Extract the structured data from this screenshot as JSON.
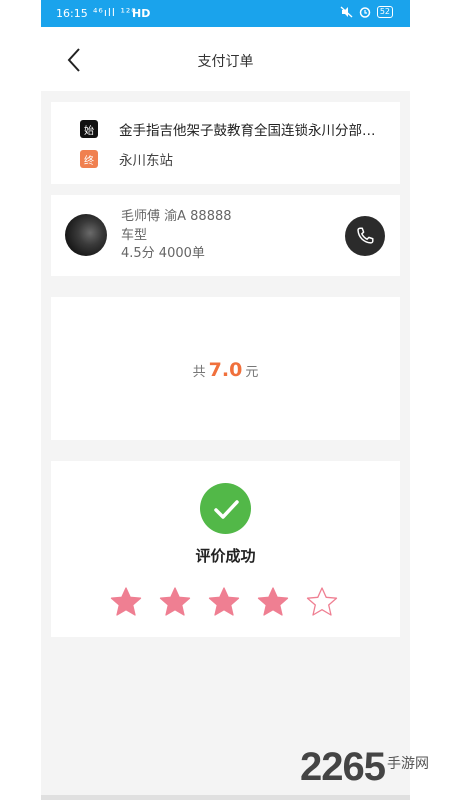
{
  "status_bar": {
    "time": "16:15",
    "signal": "⁴⁶ıll ¹²⁰",
    "network": "HD",
    "battery": "52"
  },
  "header": {
    "title": "支付订单"
  },
  "route": {
    "start_tag": "始",
    "start": "金手指吉他架子鼓教育全国连锁永川分部…",
    "end_tag": "终",
    "end": "永川东站"
  },
  "driver": {
    "name_plate": "毛师傅 渝A 88888",
    "car_model": "车型",
    "stats": "4.5分 4000单"
  },
  "payment": {
    "prefix": "共",
    "amount": "7.0",
    "unit": "元"
  },
  "rating": {
    "message": "评价成功",
    "value": 4,
    "max": 5,
    "filled_color": "#ef7f92",
    "empty_color": "#ef7f92"
  },
  "watermark": {
    "number": "2265",
    "text": "手游网"
  },
  "colors": {
    "status_bar": "#1aa3ec",
    "accent": "#f0703c",
    "success": "#52b848"
  }
}
